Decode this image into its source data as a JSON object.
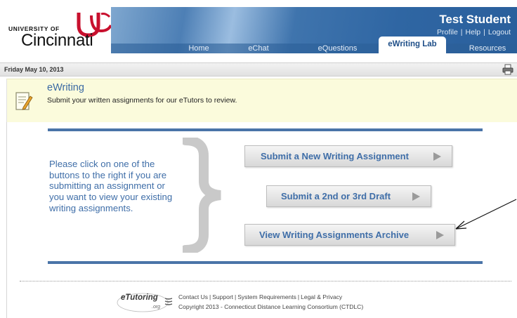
{
  "header": {
    "university_of": "UNIVERSITY OF",
    "university_name": "Cincinnati",
    "user_name": "Test Student",
    "user_links": [
      "Profile",
      "Help",
      "Logout"
    ]
  },
  "nav": {
    "tabs": [
      "Home",
      "eChat",
      "eQuestions",
      "eWriting Lab",
      "Resources"
    ],
    "active_tab": "eWriting Lab"
  },
  "datebar": {
    "date": "Friday May 10, 2013",
    "print_icon": "printer-icon"
  },
  "page": {
    "title": "eWriting",
    "subtitle": "Submit your written assignments for our eTutors to review.",
    "icon": "document-edit-icon"
  },
  "main": {
    "instructions": "Please click on one of the buttons to the right if you are submitting an assignment or you want to view your existing writing assignments.",
    "buttons": [
      "Submit a New Writing Assignment",
      "Submit a 2nd or 3rd Draft",
      "View Writing Assignments Archive"
    ]
  },
  "footer": {
    "logo_text": "eTutoring",
    "logo_sub": ".org",
    "links": [
      "Contact Us",
      "Support",
      "System Requirements",
      "Legal & Privacy"
    ],
    "copyright": "Copyright 2013 - Connecticut Distance Learning Consortium (CTDLC)"
  },
  "colors": {
    "accent_blue": "#3f6ea8",
    "rule_blue": "#4a74a8",
    "brand_red": "#c8102e",
    "title_bg": "#fbfbdc"
  }
}
